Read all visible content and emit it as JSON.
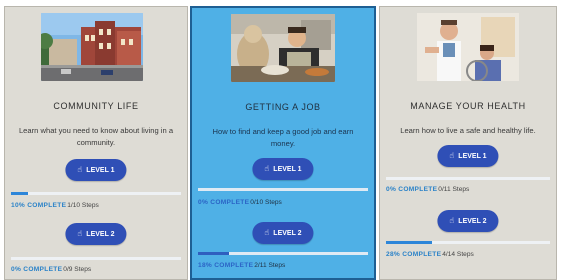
{
  "colors": {
    "card_gray": "#dedcd5",
    "card_blue": "#4fb0e6",
    "button": "#2f4fb6",
    "progress": "#2d86d9"
  },
  "cards": [
    {
      "title": "COMMUNITY LIFE",
      "description": "Learn what you need to know about living in a community.",
      "image": "town-street-photo",
      "levels": [
        {
          "label": "LEVEL 1",
          "percent_label": "10% COMPLETE",
          "steps": "1/10 Steps",
          "progress": 0.1
        },
        {
          "label": "LEVEL 2",
          "percent_label": "0% COMPLETE",
          "steps": "0/9 Steps",
          "progress": 0
        }
      ]
    },
    {
      "title": "GETTING A JOB",
      "description": "How to find and keep a good job and earn money.",
      "image": "food-worker-photo",
      "levels": [
        {
          "label": "LEVEL 1",
          "percent_label": "0% COMPLETE",
          "steps": "0/10 Steps",
          "progress": 0
        },
        {
          "label": "LEVEL 2",
          "percent_label": "18% COMPLETE",
          "steps": "2/11 Steps",
          "progress": 0.18
        }
      ]
    },
    {
      "title": "MANAGE YOUR HEALTH",
      "description": "Learn how to live a safe and healthy life.",
      "image": "doctor-patient-photo",
      "levels": [
        {
          "label": "LEVEL 1",
          "percent_label": "0% COMPLETE",
          "steps": "0/11 Steps",
          "progress": 0
        },
        {
          "label": "LEVEL 2",
          "percent_label": "28% COMPLETE",
          "steps": "4/14 Steps",
          "progress": 0.28
        }
      ]
    }
  ]
}
